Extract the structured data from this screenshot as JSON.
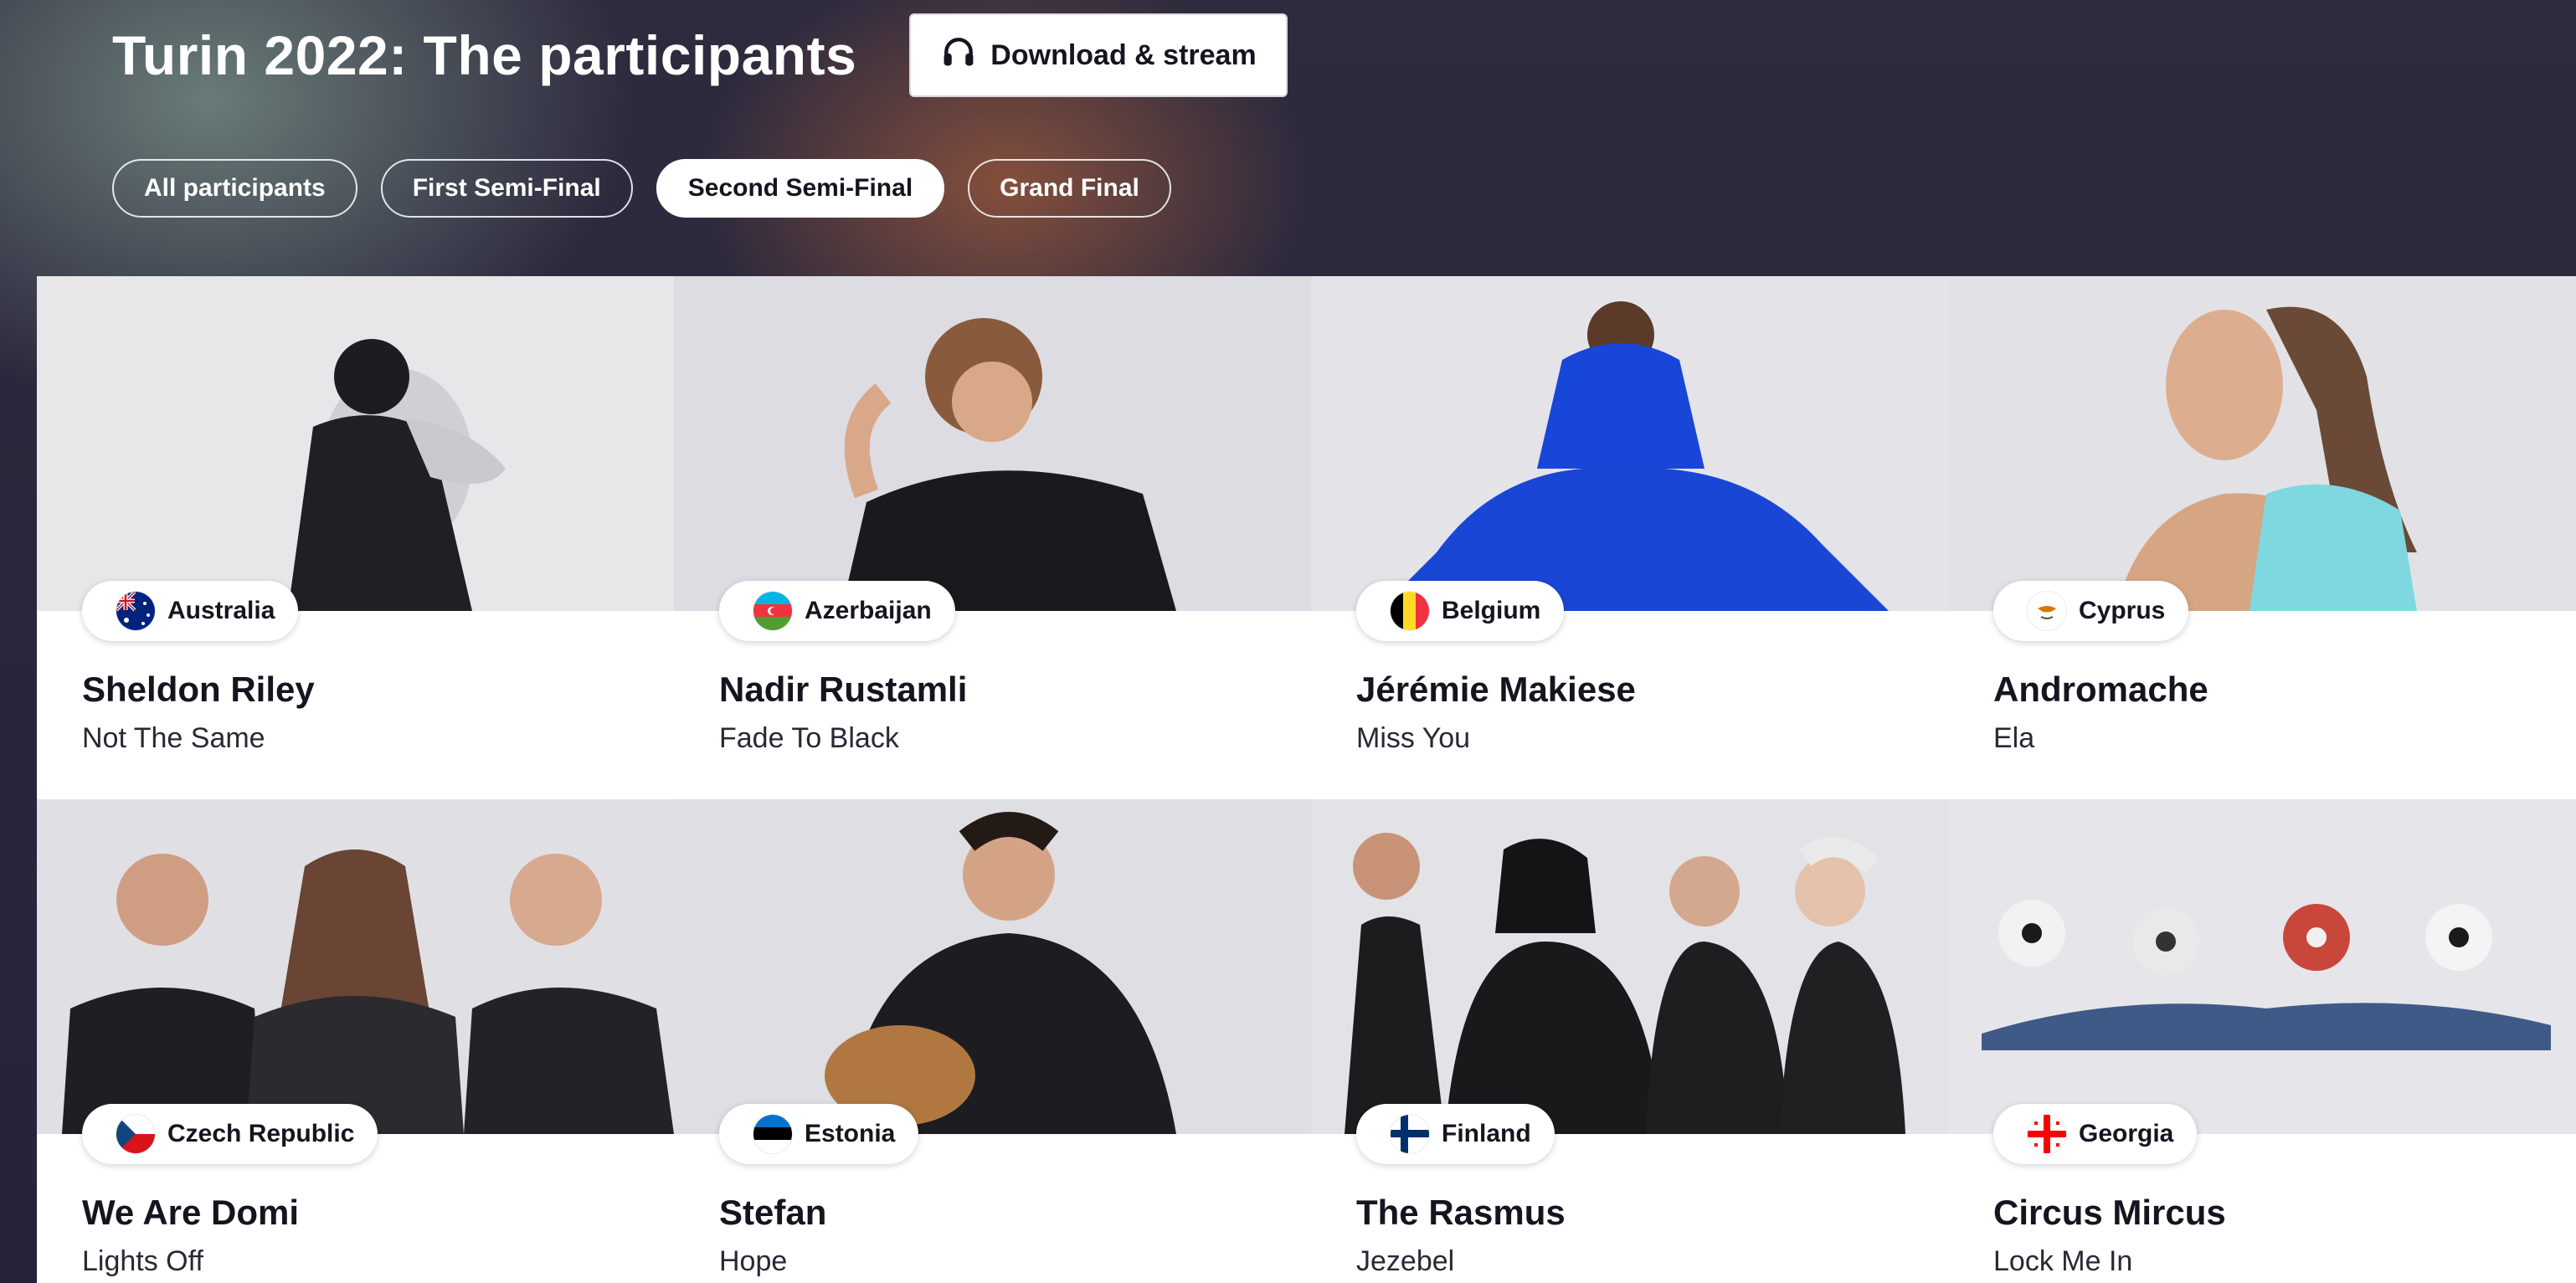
{
  "page": {
    "title": "Turin 2022: The participants",
    "download_label": "Download & stream",
    "download_icon": "headphones-icon"
  },
  "tabs": [
    {
      "label": "All participants",
      "active": false
    },
    {
      "label": "First Semi-Final",
      "active": false
    },
    {
      "label": "Second Semi-Final",
      "active": true
    },
    {
      "label": "Grand Final",
      "active": false
    }
  ],
  "colors": {
    "background_dark": "#24212f",
    "accent_glow": "#cd6e3c",
    "text_dark": "#16141f",
    "white": "#ffffff"
  },
  "participants": [
    {
      "country": "Australia",
      "artist": "Sheldon Riley",
      "song": "Not The Same",
      "flag_icon": "australia-flag-icon"
    },
    {
      "country": "Azerbaijan",
      "artist": "Nadir Rustamli",
      "song": "Fade To Black",
      "flag_icon": "azerbaijan-flag-icon"
    },
    {
      "country": "Belgium",
      "artist": "Jérémie Makiese",
      "song": "Miss You",
      "flag_icon": "belgium-flag-icon"
    },
    {
      "country": "Cyprus",
      "artist": "Andromache",
      "song": "Ela",
      "flag_icon": "cyprus-flag-icon"
    },
    {
      "country": "Czech Republic",
      "artist": "We Are Domi",
      "song": "Lights Off",
      "flag_icon": "czech-republic-flag-icon"
    },
    {
      "country": "Estonia",
      "artist": "Stefan",
      "song": "Hope",
      "flag_icon": "estonia-flag-icon"
    },
    {
      "country": "Finland",
      "artist": "The Rasmus",
      "song": "Jezebel",
      "flag_icon": "finland-flag-icon"
    },
    {
      "country": "Georgia",
      "artist": "Circus Mircus",
      "song": "Lock Me In",
      "flag_icon": "georgia-flag-icon"
    }
  ]
}
